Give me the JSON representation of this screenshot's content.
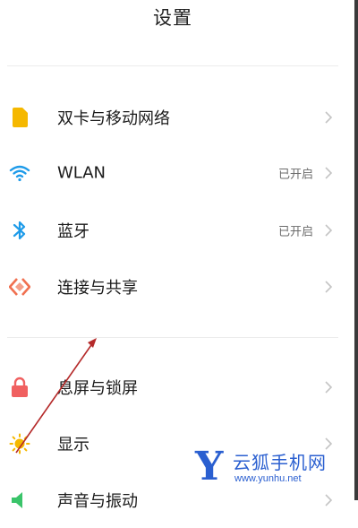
{
  "header": {
    "title": "设置"
  },
  "settings": [
    {
      "label": "双卡与移动网络",
      "status": "",
      "icon": "sim-card-icon",
      "color": "#f5b800"
    },
    {
      "label": "WLAN",
      "status": "已开启",
      "icon": "wifi-icon",
      "color": "#1e9be9"
    },
    {
      "label": "蓝牙",
      "status": "已开启",
      "icon": "bluetooth-icon",
      "color": "#1e9be9"
    },
    {
      "label": "连接与共享",
      "status": "",
      "icon": "connection-share-icon",
      "color": "#f07050"
    },
    {
      "label": "息屏与锁屏",
      "status": "",
      "icon": "lock-icon",
      "color": "#f06060"
    },
    {
      "label": "显示",
      "status": "",
      "icon": "sun-icon",
      "color": "#f5b800"
    },
    {
      "label": "声音与振动",
      "status": "",
      "icon": "speaker-icon",
      "color": "#3ac46a"
    }
  ],
  "watermark": {
    "letter": "Y",
    "text": "云狐手机网",
    "url": "www.yunhu.net"
  }
}
